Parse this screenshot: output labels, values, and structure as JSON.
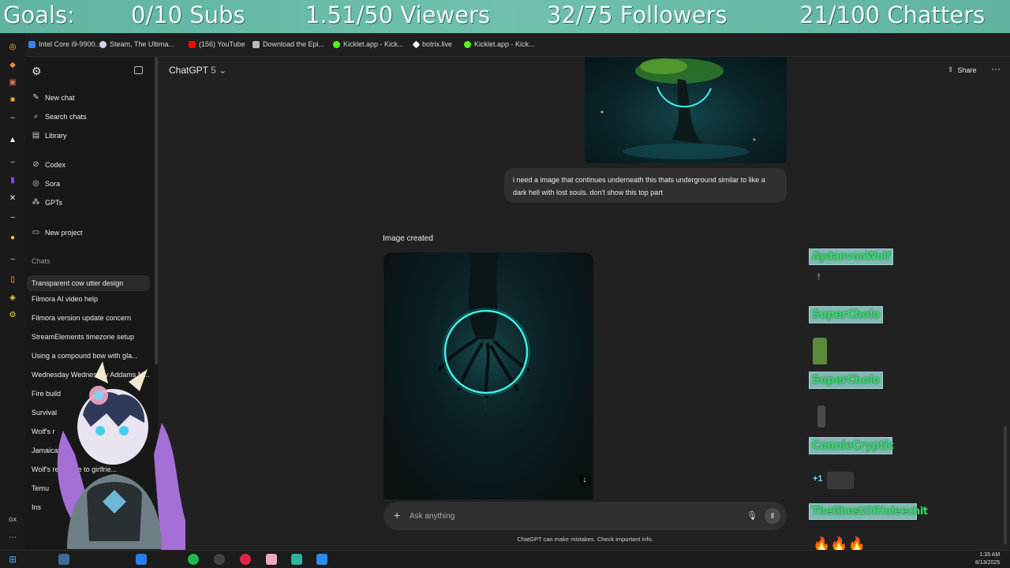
{
  "goals": {
    "label": "Goals:",
    "subs": "0/10 Subs",
    "viewers": "1.51/50 Viewers",
    "followers": "32/75 Followers",
    "chatters": "21/100 Chatters"
  },
  "bookmarks": [
    {
      "label": "Intel Core i9-9900...",
      "color": "#3b82f6"
    },
    {
      "label": "Steam, The Ultima...",
      "color": "#cfd8e3"
    },
    {
      "label": "(156) YouTube",
      "color": "#ff0000"
    },
    {
      "label": "Download the Epi...",
      "color": "#bbbbbb"
    },
    {
      "label": "Kicklet.app - Kick...",
      "color": "#53fc18"
    },
    {
      "label": "botrix.live",
      "color": "#ffffff"
    },
    {
      "label": "Kicklet.app - Kick...",
      "color": "#53fc18"
    }
  ],
  "sidebar": {
    "logo_icon": "openai-logo-icon",
    "top_items": [
      {
        "icon": "✎",
        "label": "New chat"
      },
      {
        "icon": "⌕",
        "label": "Search chats"
      },
      {
        "icon": "▤",
        "label": "Library"
      }
    ],
    "tools": [
      {
        "icon": "⊘",
        "label": "Codex"
      },
      {
        "icon": "◎",
        "label": "Sora"
      },
      {
        "icon": "⁂",
        "label": "GPTs"
      }
    ],
    "project": {
      "icon": "▭",
      "label": "New project"
    },
    "chats_heading": "Chats",
    "chats": [
      "Transparent cow utter design",
      "Filmora AI video help",
      "Filmora version update concern",
      "StreamElements timezone setup",
      "Using a compound bow with gla...",
      "Wednesday Wednesday Addams M...",
      "Fire build",
      "Survival",
      "Wolf's r",
      "Jamaican",
      "Wolf's response to girlfrie...",
      "Temu",
      "Ins"
    ]
  },
  "header": {
    "model": "ChatGPT",
    "model_version": "5",
    "share_label": "Share",
    "more_label": "···"
  },
  "conversation": {
    "user_message": "i need a image that continues underneath this thats underground similar to like a dark hell with lost souls. don't show this top part",
    "image_status": "Image created"
  },
  "composer": {
    "placeholder": "Ask anything",
    "disclaimer": "ChatGPT can make mistakes. Check important info."
  },
  "stream_chat": [
    {
      "name": "AydanvonWolf",
      "message": ""
    },
    {
      "name": "SuperCholo",
      "message": ""
    },
    {
      "name": "SuperCholo",
      "message": ""
    },
    {
      "name": "ConnieCryptic",
      "message": "+1"
    },
    {
      "name": "TheGhostOfHoleechit",
      "message": ""
    }
  ],
  "clock": {
    "time": "1:35 AM",
    "date": "8/13/2025"
  }
}
